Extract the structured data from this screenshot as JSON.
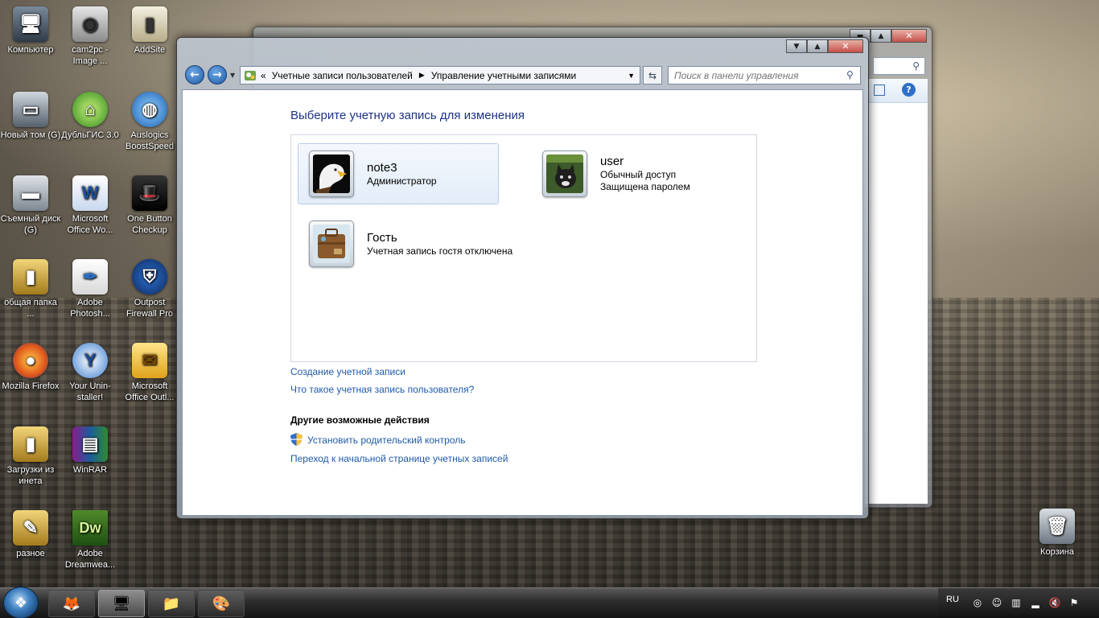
{
  "desktop": {
    "icons": [
      {
        "label": "Компьютер",
        "icon": "computer-icon"
      },
      {
        "label": "cam2pc - Image ...",
        "icon": "camera-icon"
      },
      {
        "label": "AddSite",
        "icon": "document-icon"
      },
      {
        "label": "Новый том (G)",
        "icon": "drive-icon"
      },
      {
        "label": "ДубльГИС 3.0",
        "icon": "map-icon"
      },
      {
        "label": "Auslogics BoostSpeed",
        "icon": "globe-icon"
      },
      {
        "label": "Съемный диск (G)",
        "icon": "removable-drive-icon"
      },
      {
        "label": "Microsoft Office Wo...",
        "icon": "word-icon"
      },
      {
        "label": "One Button Checkup",
        "icon": "hat-icon"
      },
      {
        "label": "общая папка ...",
        "icon": "folder-icon"
      },
      {
        "label": "Adobe Photosh...",
        "icon": "feather-icon"
      },
      {
        "label": "Outpost Firewall Pro",
        "icon": "shield-icon"
      },
      {
        "label": "Mozilla Firefox",
        "icon": "firefox-icon"
      },
      {
        "label": "Your Unin-staller!",
        "icon": "uninstaller-icon"
      },
      {
        "label": "Microsoft Office Outl...",
        "icon": "outlook-icon"
      },
      {
        "label": "Загрузки из инета",
        "icon": "folder-icon"
      },
      {
        "label": "WinRAR",
        "icon": "winrar-icon"
      },
      {
        "label": "разное",
        "icon": "folder-icon"
      },
      {
        "label": "Adobe Dreamwea...",
        "icon": "dreamweaver-icon"
      }
    ],
    "recycle_bin": "Корзина"
  },
  "window": {
    "breadcrumb": {
      "prefix": "«",
      "item1": "Учетные записи пользователей",
      "item2": "Управление учетными записями"
    },
    "search_placeholder": "Поиск в панели управления",
    "title": "Выберите учетную запись для изменения",
    "accounts": [
      {
        "name": "note3",
        "line1": "Администратор",
        "line2": ""
      },
      {
        "name": "user",
        "line1": "Обычный доступ",
        "line2": "Защищена паролем"
      },
      {
        "name": "Гость",
        "line1": "Учетная запись гостя отключена",
        "line2": ""
      }
    ],
    "links": {
      "create": "Создание учетной записи",
      "what_is": "Что такое учетная запись пользователя?"
    },
    "other_actions_heading": "Другие возможные действия",
    "other_actions": {
      "parental": "Установить родительский контроль",
      "home": "Переход к начальной странице учетных записей"
    }
  },
  "taskbar": {
    "language": "RU"
  },
  "colors": {
    "link": "#1e5aa8",
    "title": "#1e3287",
    "selection": "#e3edf9"
  }
}
